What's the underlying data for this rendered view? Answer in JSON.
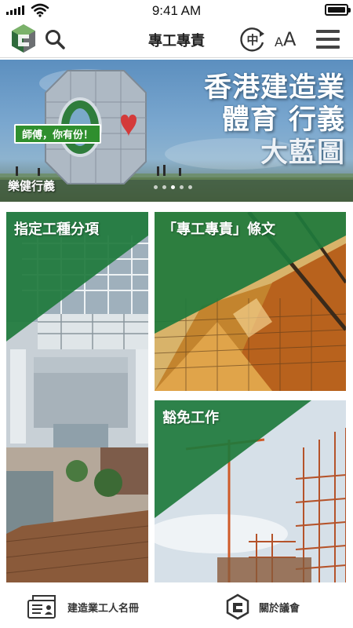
{
  "status_bar": {
    "time": "9:41 AM"
  },
  "header": {
    "title": "專工專責",
    "lang_glyph": "中",
    "font_small": "A",
    "font_large": "A"
  },
  "banner": {
    "headline_line1": "香港建造業",
    "headline_line2": "體育 行義",
    "headline_line3": "大藍圖",
    "tag": "師傅，你有份！",
    "caption": "樂健行義",
    "slide_count": 5,
    "active_slide": 2
  },
  "tiles": {
    "designated_trades": "指定工種分項",
    "provisions": "「專工專責」條文",
    "exempted_work": "豁免工作"
  },
  "bottom_nav": {
    "registry": "建造業工人名冊",
    "about": "關於議會"
  },
  "colors": {
    "brand_green": "#1e7a3c",
    "text_dark": "#222222"
  },
  "icons": [
    "signal-icon",
    "wifi-icon",
    "battery-icon",
    "logo-icon",
    "search-icon",
    "language-icon",
    "menu-icon",
    "id-card-icon",
    "council-logo-icon"
  ]
}
